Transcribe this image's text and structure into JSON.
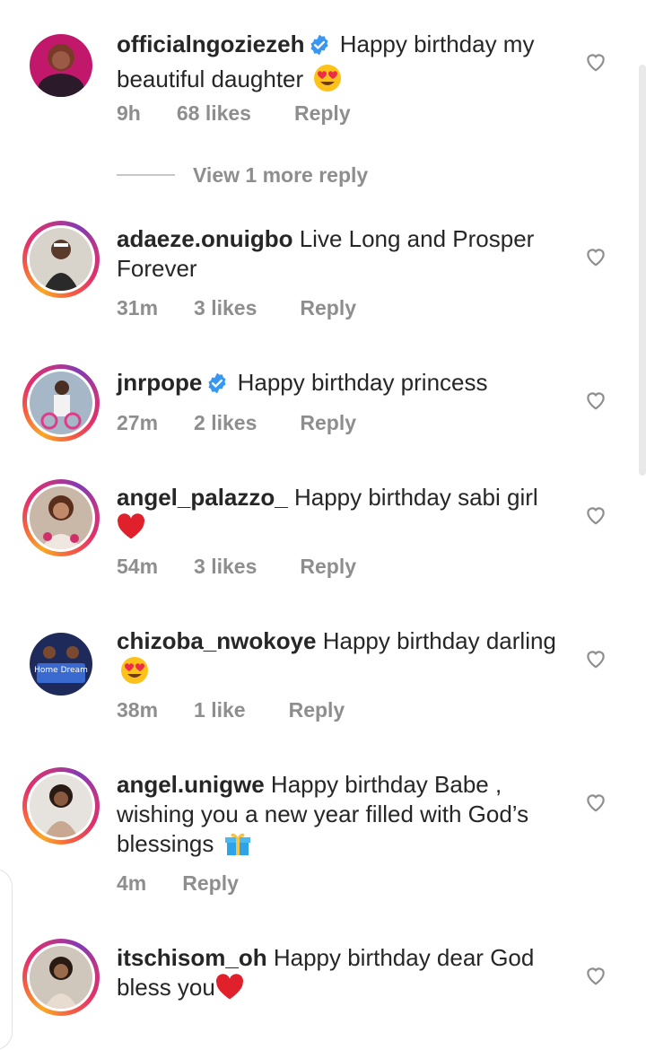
{
  "comments": [
    {
      "username": "officialngoziezeh",
      "verified": true,
      "text": "Happy birthday my beautiful daughter",
      "emoji": "heart-eyes",
      "time": "9h",
      "likes": "68 likes",
      "reply": "Reply"
    },
    {
      "username": "adaeze.onuigbo",
      "verified": false,
      "text": "Live Long and Prosper Forever",
      "time": "31m",
      "likes": "3 likes",
      "reply": "Reply"
    },
    {
      "username": "jnrpope",
      "verified": true,
      "text": "Happy birthday princess",
      "time": "27m",
      "likes": "2 likes",
      "reply": "Reply"
    },
    {
      "username": "angel_palazzo_",
      "verified": false,
      "text": "Happy birthday sabi girl",
      "emoji": "red-heart",
      "time": "54m",
      "likes": "3 likes",
      "reply": "Reply"
    },
    {
      "username": "chizoba_nwokoye",
      "verified": false,
      "text": "Happy birthday darling",
      "emoji": "heart-eyes",
      "time": "38m",
      "likes": "1 like",
      "reply": "Reply"
    },
    {
      "username": "angel.unigwe",
      "verified": false,
      "text": "Happy birthday Babe , wishing you a new year filled with God’s blessings",
      "emoji": "gift",
      "time": "4m",
      "reply": "Reply"
    },
    {
      "username": "itschisom_oh",
      "verified": false,
      "text": "Happy birthday dear God bless you",
      "emoji": "red-heart",
      "time": "",
      "likes": "",
      "reply": ""
    }
  ],
  "view_more_replies": "View 1 more reply",
  "avatar_art": {
    "chizoba_nwokoye": "Home Dream"
  },
  "colors": {
    "verified": "#3897f0",
    "meta_text": "#8e8e8e",
    "heart_emoji": "#e0202b"
  }
}
